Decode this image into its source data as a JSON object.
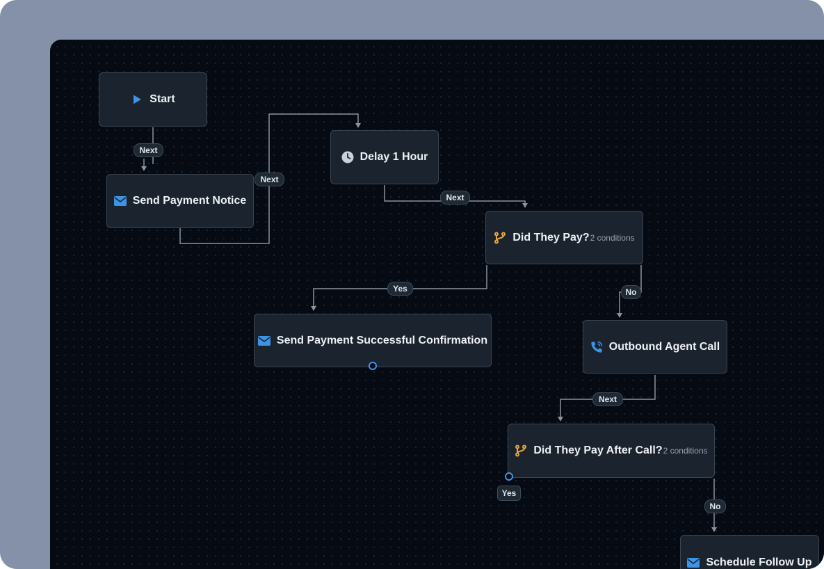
{
  "nodes": {
    "start": {
      "label": "Start",
      "icon": "play-icon"
    },
    "send_payment_notice": {
      "label": "Send Payment Notice",
      "icon": "envelope-icon"
    },
    "delay": {
      "label": "Delay 1 Hour",
      "icon": "clock-icon"
    },
    "did_they_pay": {
      "label": "Did They Pay?",
      "sub": "2 conditions",
      "icon": "branch-icon"
    },
    "send_confirmation": {
      "label": "Send Payment Successful Confirmation",
      "icon": "envelope-icon"
    },
    "outbound_call": {
      "label": "Outbound Agent Call",
      "icon": "phone-call-icon"
    },
    "did_they_pay_after_call": {
      "label": "Did They Pay After Call?",
      "sub": "2 conditions",
      "icon": "branch-icon"
    },
    "schedule_follow_up": {
      "label": "Schedule Follow Up",
      "icon": "envelope-icon"
    }
  },
  "edge_labels": {
    "start_next": "Next",
    "notice_next": "Next",
    "delay_next": "Next",
    "pay_yes": "Yes",
    "pay_no": "No",
    "call_next": "Next",
    "after_call_yes": "Yes",
    "after_call_no": "No"
  },
  "colors": {
    "outer_frame": "#8591a8",
    "canvas": "#060a12",
    "node_bg": "#1b232e",
    "node_border": "#3a4552",
    "edge": "#8a939e",
    "accent_blue": "#3d94e6",
    "accent_amber": "#e8a83a"
  }
}
